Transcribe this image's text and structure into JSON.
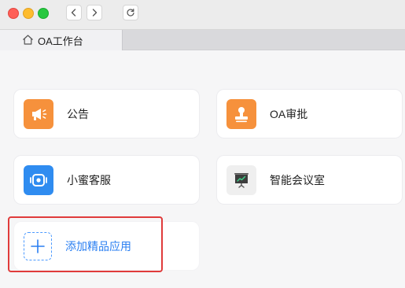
{
  "window": {
    "buttons": {
      "close": "close",
      "minimize": "minimize",
      "zoom": "zoom"
    },
    "nav_icons": {
      "back": "chevron-left-icon",
      "forward": "chevron-right-icon",
      "reload": "reload-icon"
    }
  },
  "tab": {
    "label": "OA工作台",
    "icon": "home-icon"
  },
  "apps": [
    {
      "label": "公告",
      "icon": "megaphone-icon",
      "color": "#f6913c"
    },
    {
      "label": "OA审批",
      "icon": "stamp-icon",
      "color": "#f6913c"
    },
    {
      "label": "小蜜客服",
      "icon": "customer-service-icon",
      "color": "#2f8cf0"
    },
    {
      "label": "智能会议室",
      "icon": "presentation-board-icon",
      "color": "#efefef"
    }
  ],
  "add_app": {
    "label": "添加精品应用",
    "icon": "plus-icon",
    "color": "#2a7ff2"
  },
  "highlight_color": "#e03b3b"
}
